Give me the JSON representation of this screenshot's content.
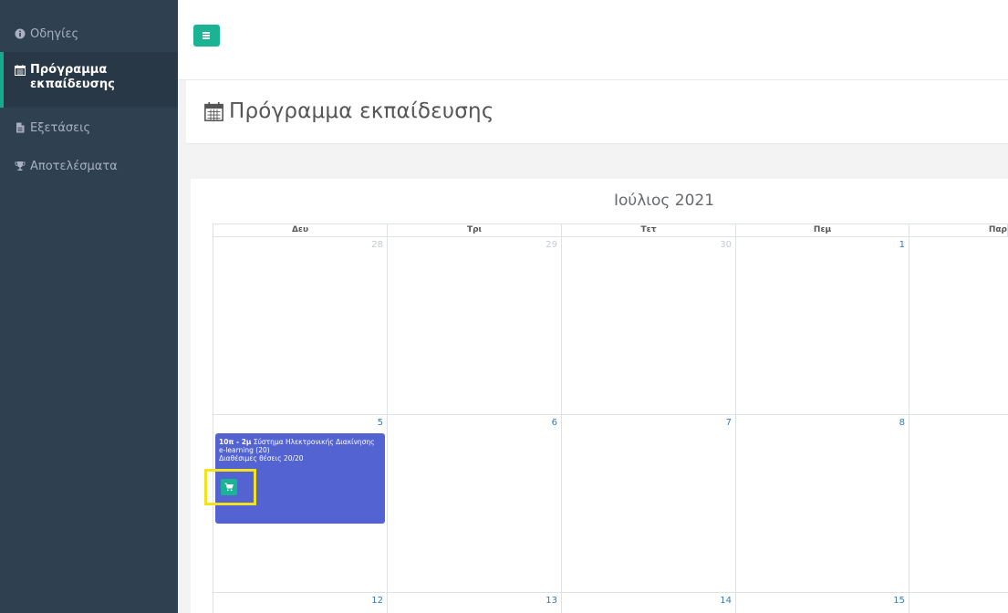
{
  "sidebar": {
    "items": [
      {
        "label": "Οδηγίες",
        "icon": "info-circle-icon",
        "active": false
      },
      {
        "label": "Πρόγραμμα εκπαίδευσης",
        "icon": "calendar-icon",
        "active": true
      },
      {
        "label": "Εξετάσεις",
        "icon": "file-icon",
        "active": false
      },
      {
        "label": "Αποτελέσματα",
        "icon": "trophy-icon",
        "active": false
      }
    ]
  },
  "header": {
    "menu_icon": "hamburger-menu-icon"
  },
  "page": {
    "title": "Πρόγραμμα εκπαίδευσης",
    "title_icon": "calendar-icon"
  },
  "calendar": {
    "month_title": "Ιούλιος 2021",
    "weekdays": [
      "Δευ",
      "Τρι",
      "Τετ",
      "Πεμ",
      "Παρ"
    ],
    "weeks": [
      [
        "28",
        "29",
        "30",
        "1",
        ""
      ],
      [
        "5",
        "6",
        "7",
        "8",
        ""
      ],
      [
        "12",
        "13",
        "14",
        "15",
        ""
      ]
    ],
    "event": {
      "time": "10π - 2μ",
      "title": " Σύστημα Ηλεκτρονικής Διακίνησης",
      "line2": "e-learning (20)",
      "line3": "Διαθέσιμες θέσεις 20/20",
      "cart_icon": "shopping-cart-icon"
    }
  },
  "colors": {
    "sidebar_bg": "#2f4050",
    "accent": "#1ab394",
    "event_bg": "#5364d2",
    "highlight": "#f4e21c",
    "link": "#337ab7"
  }
}
